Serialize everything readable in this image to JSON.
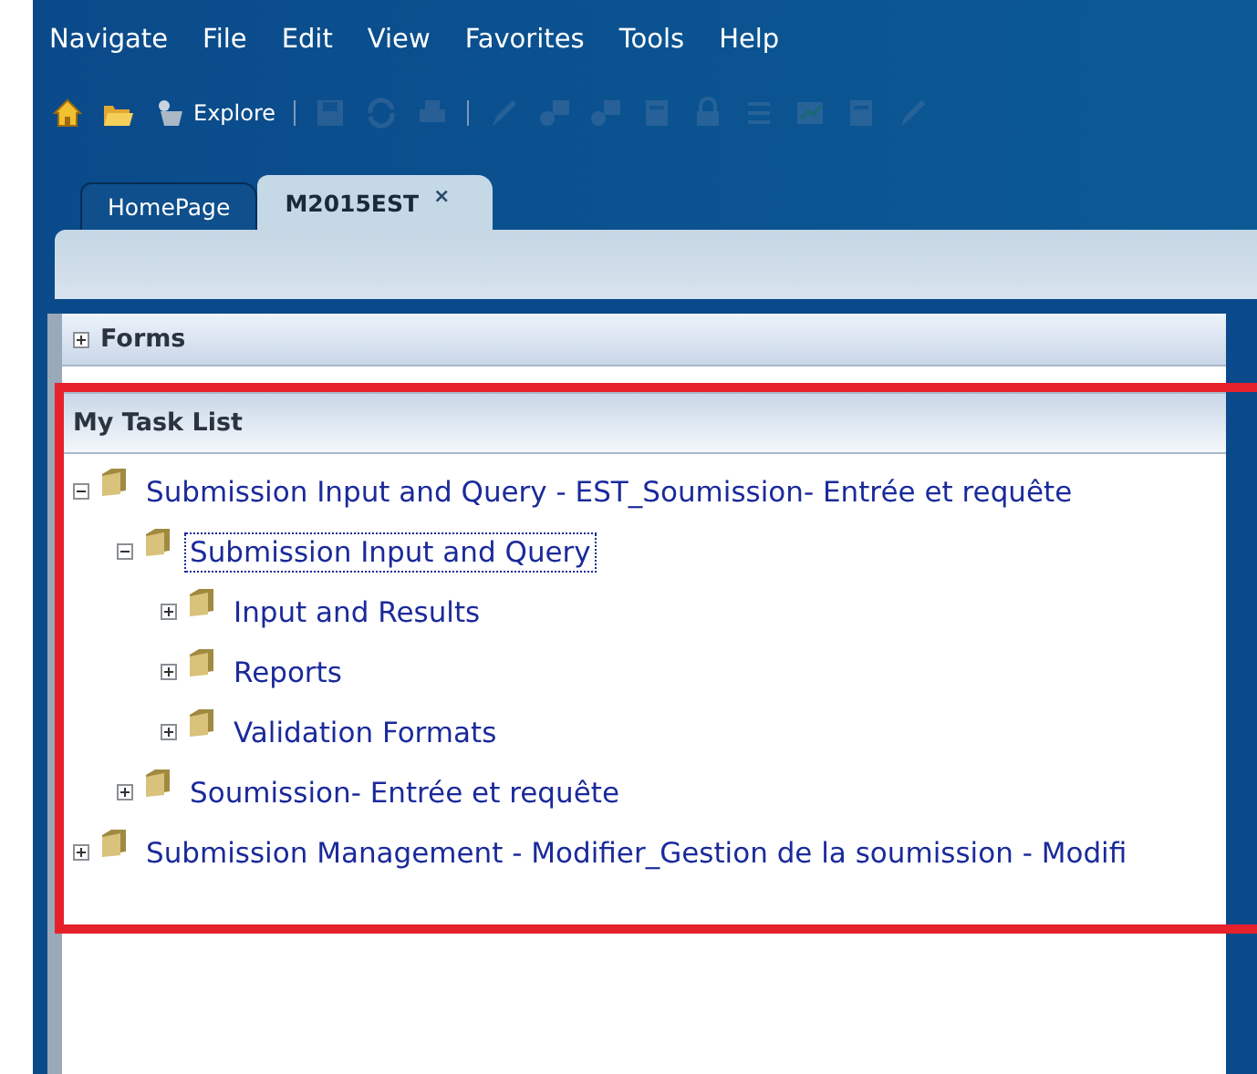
{
  "menu": [
    "Navigate",
    "File",
    "Edit",
    "View",
    "Favorites",
    "Tools",
    "Help"
  ],
  "toolbar": [
    {
      "kind": "home",
      "disabled": false
    },
    {
      "kind": "open",
      "disabled": false
    },
    {
      "kind": "explore",
      "disabled": false,
      "label": "Explore"
    },
    {
      "kind": "separator"
    },
    {
      "kind": "save",
      "disabled": true
    },
    {
      "kind": "refresh",
      "disabled": true
    },
    {
      "kind": "print",
      "disabled": true
    },
    {
      "kind": "separator"
    },
    {
      "kind": "pencil",
      "disabled": true
    },
    {
      "kind": "grid",
      "disabled": true
    },
    {
      "kind": "grid",
      "disabled": true
    },
    {
      "kind": "sheet",
      "disabled": true
    },
    {
      "kind": "lock",
      "disabled": true
    },
    {
      "kind": "list",
      "disabled": true
    },
    {
      "kind": "chart",
      "disabled": true
    },
    {
      "kind": "sheet",
      "disabled": true
    },
    {
      "kind": "pencil",
      "disabled": true
    }
  ],
  "tabs": [
    {
      "label": "HomePage",
      "selected": false,
      "closable": false
    },
    {
      "label": "M2015EST",
      "selected": true,
      "closable": true,
      "close": "×"
    }
  ],
  "forms_panel": {
    "title": "Forms",
    "expanded": false
  },
  "task_list": {
    "title": "My Task List",
    "items": [
      {
        "label": "Submission Input and Query - EST_Soumission- Entrée et requête",
        "expanded": true,
        "selected": false,
        "children": [
          {
            "label": "Submission Input and Query",
            "expanded": true,
            "selected": true,
            "children": [
              {
                "label": "Input and Results",
                "expanded": false,
                "selected": false
              },
              {
                "label": "Reports",
                "expanded": false,
                "selected": false
              },
              {
                "label": "Validation Formats",
                "expanded": false,
                "selected": false
              }
            ]
          },
          {
            "label": "Soumission- Entrée et requête",
            "expanded": false,
            "selected": false
          }
        ]
      },
      {
        "label": "Submission Management - Modifier_Gestion de la soumission - Modifi",
        "expanded": false,
        "selected": false
      }
    ]
  }
}
